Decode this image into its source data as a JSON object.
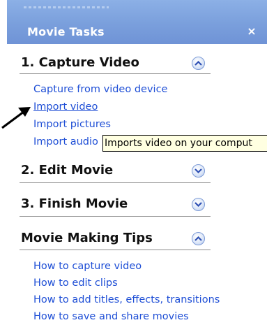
{
  "task_pane": {
    "title": "Movie Tasks",
    "close_glyph": "×"
  },
  "capture": {
    "title": "1. Capture Video",
    "state": "expanded",
    "links": [
      "Capture from video device",
      "Import video",
      "Import pictures",
      "Import audio or music"
    ],
    "visible_links": [
      "Capture from video device",
      "Import video",
      "Import pictures",
      "Import audio"
    ]
  },
  "edit": {
    "title": "2. Edit Movie",
    "state": "collapsed"
  },
  "finish": {
    "title": "3. Finish Movie",
    "state": "collapsed"
  },
  "tips": {
    "title": "Movie Making Tips",
    "state": "expanded",
    "links": [
      "How to capture video",
      "How to edit clips",
      "How to add titles, effects, transitions",
      "How to save and share movies"
    ]
  },
  "tooltip": {
    "text": "Imports video on your comput"
  },
  "colors": {
    "header_blue": "#7a9fdc",
    "link_blue": "#1f4fd6",
    "tooltip_bg": "#ffffe1"
  },
  "icons": {
    "expand": "chevron-up-icon",
    "collapse": "chevron-down-icon",
    "pointer": "arrow-pointer-icon"
  }
}
